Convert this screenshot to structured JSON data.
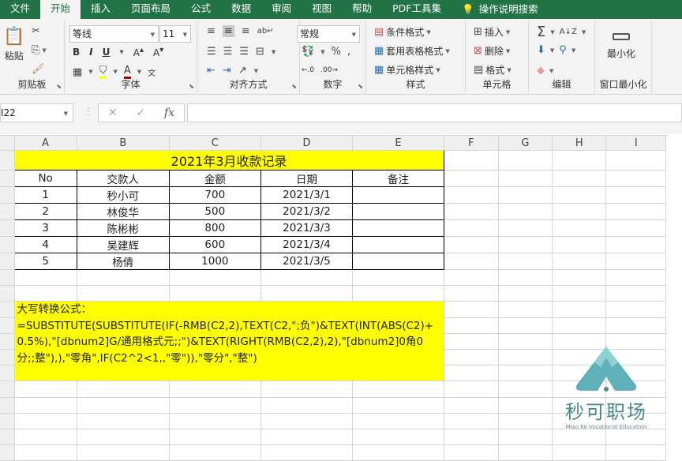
{
  "tabs": [
    "文件",
    "开始",
    "插入",
    "页面布局",
    "公式",
    "数据",
    "审阅",
    "视图",
    "帮助",
    "PDF工具集"
  ],
  "active_tab": "开始",
  "search_label": "操作说明搜索",
  "ribbon": {
    "clipboard": {
      "paste": "粘贴",
      "label": "剪贴板"
    },
    "font": {
      "name": "等线",
      "size": "11",
      "label": "字体"
    },
    "align": {
      "label": "对齐方式"
    },
    "number": {
      "format": "常规",
      "label": "数字"
    },
    "styles": {
      "cond": "条件格式",
      "table": "套用表格格式",
      "cell": "单元格样式",
      "label": "样式"
    },
    "cells": {
      "insert": "插入",
      "delete": "删除",
      "format": "格式",
      "label": "单元格"
    },
    "edit": {
      "label": "编辑"
    },
    "minimize": {
      "btn": "最小化",
      "label": "窗口最小化"
    }
  },
  "namebox": "I22",
  "columns": [
    "A",
    "B",
    "C",
    "D",
    "E",
    "F",
    "G",
    "H",
    "I"
  ],
  "title": "2021年3月收款记录",
  "headers": [
    "No",
    "交款人",
    "金额",
    "日期",
    "备注"
  ],
  "rows": [
    [
      "1",
      "秒小可",
      "700",
      "2021/3/1",
      ""
    ],
    [
      "2",
      "林俊华",
      "500",
      "2021/3/2",
      ""
    ],
    [
      "3",
      "陈彬彬",
      "800",
      "2021/3/3",
      ""
    ],
    [
      "4",
      "吴建辉",
      "600",
      "2021/3/4",
      ""
    ],
    [
      "5",
      "杨倩",
      "1000",
      "2021/3/5",
      ""
    ]
  ],
  "formula_label": "大写转换公式：",
  "formula": "=SUBSTITUTE(SUBSTITUTE(IF(-RMB(C2,2),TEXT(C2,\";负\")&TEXT(INT(ABS(C2)+0.5%),\"[dbnum2]G/通用格式元;;\")&TEXT(RIGHT(RMB(C2,2),2),\"[dbnum2]0角0分;;整\"),),\"零角\",IF(C2^2<1,,\"零\")),\"零分\",\"整\")",
  "watermark": {
    "title": "秒可职场",
    "subtitle": "Miao Ke Vocational Education"
  }
}
